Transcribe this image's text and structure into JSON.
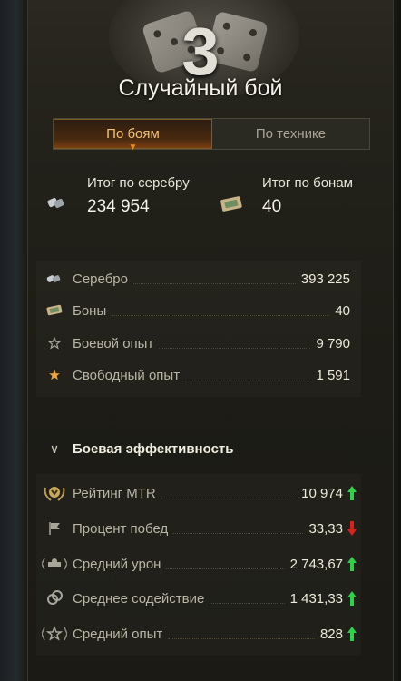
{
  "header": {
    "number": "3",
    "title": "Случайный бой"
  },
  "tabs": [
    {
      "label": "По боям",
      "active": true
    },
    {
      "label": "По технике",
      "active": false
    }
  ],
  "totals": {
    "silver": {
      "label": "Итог по серебру",
      "value": "234 954",
      "icon": "silver-coin-icon"
    },
    "bonds": {
      "label": "Итог по бонам",
      "value": "40",
      "icon": "bond-icon"
    }
  },
  "earnings": [
    {
      "label": "Серебро",
      "value": "393 225",
      "icon": "silver-coin-icon"
    },
    {
      "label": "Боны",
      "value": "40",
      "icon": "bond-icon"
    },
    {
      "label": "Боевой опыт",
      "value": "9 790",
      "icon": "star-outline-icon"
    },
    {
      "label": "Свободный опыт",
      "value": "1 591",
      "icon": "star-gold-icon"
    }
  ],
  "efficiency": {
    "title": "Боевая эффективность",
    "rows": [
      {
        "label": "Рейтинг MTR",
        "value": "10 974",
        "trend": "up",
        "icon": "mtr-rating-icon"
      },
      {
        "label": "Процент побед",
        "value": "33,33",
        "trend": "down",
        "icon": "flag-icon"
      },
      {
        "label": "Средний урон",
        "value": "2 743,67",
        "trend": "up",
        "icon": "damage-icon"
      },
      {
        "label": "Среднее содействие",
        "value": "1 431,33",
        "trend": "up",
        "icon": "assist-icon"
      },
      {
        "label": "Средний опыт",
        "value": "828",
        "trend": "up",
        "icon": "avg-xp-icon"
      }
    ]
  },
  "colors": {
    "trend_up": "#2bd24a",
    "trend_down": "#d6231c",
    "tab_active_text": "#f5c27a",
    "gold": "#f0a63a"
  }
}
